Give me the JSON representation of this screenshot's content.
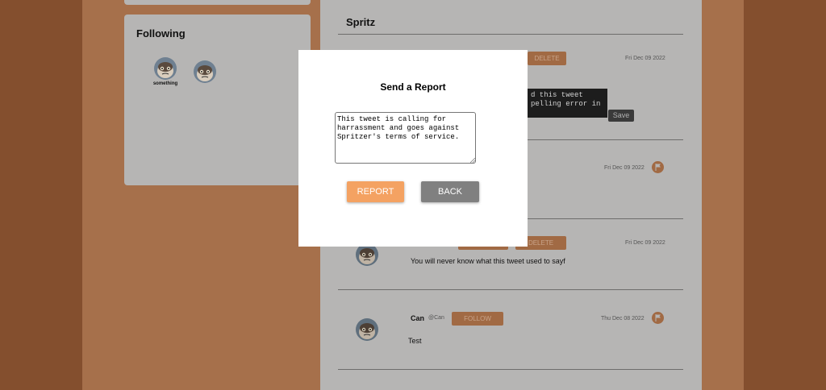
{
  "following": {
    "title": "Following",
    "users": [
      {
        "name": "something"
      },
      {
        "name": ""
      }
    ]
  },
  "feed": {
    "title": "Spritz",
    "tweets": [
      {
        "date": "Fri Dec 09 2022",
        "delete_label": "DELETE",
        "edit_text": "d this tweet\npelling error in",
        "save_label": "Save"
      },
      {
        "date": "Fri Dec 09 2022"
      },
      {
        "date": "Fri Dec 09 2022",
        "delete_label": "DELETE",
        "text": "You will never know what this tweet used to sayf"
      },
      {
        "name": "Can",
        "handle": "@Can",
        "follow_label": "FOLLOW",
        "date": "Thu Dec 08 2022",
        "text": "Test"
      }
    ]
  },
  "modal": {
    "title": "Send a Report",
    "report_text": "This tweet is calling for harrassment and goes against Spritzer's terms of service.",
    "report_label": "REPORT",
    "back_label": "BACK"
  },
  "colors": {
    "accent": "#f4a262",
    "background": "#844f2e",
    "modal": "#ffffff",
    "back_button": "#808080"
  },
  "icons": [
    "grumpy-cat-avatar-icon",
    "flag-icon",
    "resize-grip-icon"
  ]
}
